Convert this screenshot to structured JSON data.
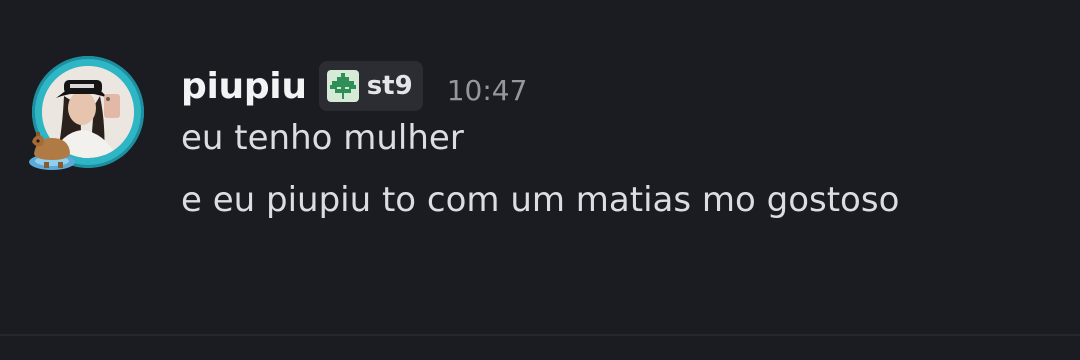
{
  "message": {
    "username": "piupiu",
    "tag": {
      "icon": "leaf-icon",
      "text": "st9"
    },
    "timestamp": "10:47",
    "lines": [
      "eu tenho mulher",
      "e eu piupiu to com um matias mo gostoso"
    ]
  },
  "avatar": {
    "frame_color": "#2fb6c4",
    "decoration": "capybara-icon"
  }
}
